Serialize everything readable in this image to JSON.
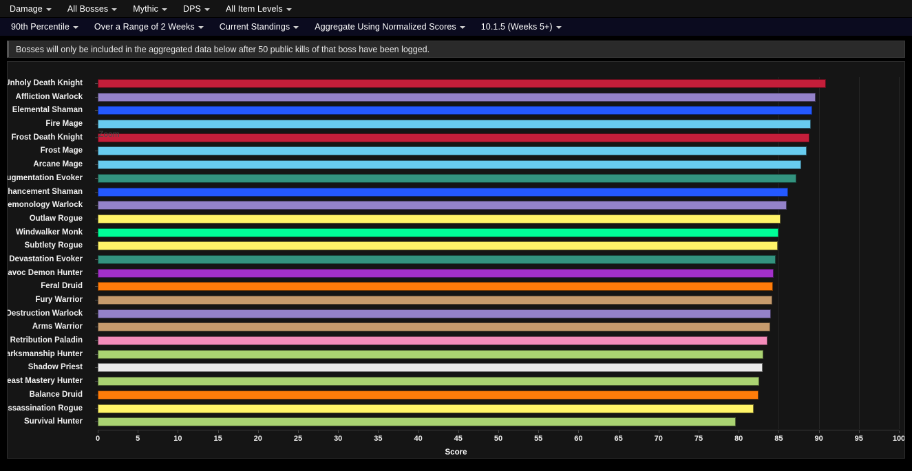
{
  "menubar_primary": [
    {
      "label": "Damage",
      "caret": true
    },
    {
      "label": "All Bosses",
      "caret": true
    },
    {
      "label": "Mythic",
      "caret": true
    },
    {
      "label": "DPS",
      "caret": true
    },
    {
      "label": "All Item Levels",
      "caret": true
    }
  ],
  "menubar_secondary": [
    {
      "label": "90th Percentile",
      "caret": true
    },
    {
      "label": "Over a Range of 2 Weeks",
      "caret": true
    },
    {
      "label": "Current Standings",
      "caret": true
    },
    {
      "label": "Aggregate Using Normalized Scores",
      "caret": true
    },
    {
      "label": "10.1.5 (Weeks 5+)",
      "caret": true
    }
  ],
  "notice": {
    "text": "Bosses will only be included in the aggregated data below after 50 public kills of that boss have been logged."
  },
  "chart_panel": {
    "zoom_label": "Zoom"
  },
  "chart_data": {
    "type": "bar",
    "orientation": "horizontal",
    "title": "",
    "xlabel": "Score",
    "ylabel": "",
    "xlim": [
      0,
      100
    ],
    "xticks": [
      0,
      5,
      10,
      15,
      20,
      25,
      30,
      35,
      40,
      45,
      50,
      55,
      60,
      65,
      70,
      75,
      80,
      85,
      90,
      95,
      100
    ],
    "gridlines": [
      85,
      90,
      95,
      100
    ],
    "grid": true,
    "legend": "none",
    "categories": [
      "Unholy Death Knight",
      "Affliction Warlock",
      "Elemental Shaman",
      "Fire Mage",
      "Frost Death Knight",
      "Frost Mage",
      "Arcane Mage",
      "Augmentation Evoker",
      "Enhancement Shaman",
      "Demonology Warlock",
      "Outlaw Rogue",
      "Windwalker Monk",
      "Subtlety Rogue",
      "Devastation Evoker",
      "Havoc Demon Hunter",
      "Feral Druid",
      "Fury Warrior",
      "Destruction Warlock",
      "Arms Warrior",
      "Retribution Paladin",
      "Marksmanship Hunter",
      "Shadow Priest",
      "Beast Mastery Hunter",
      "Balance Druid",
      "Assassination Rogue",
      "Survival Hunter"
    ],
    "values": [
      90.9,
      89.6,
      89.2,
      89.0,
      88.8,
      88.5,
      87.8,
      87.2,
      86.2,
      86.0,
      85.2,
      85.0,
      84.9,
      84.6,
      84.4,
      84.3,
      84.2,
      84.0,
      83.9,
      83.6,
      83.1,
      83.0,
      82.6,
      82.5,
      81.9,
      79.6
    ],
    "colors": [
      "#c41e3a",
      "#9482c9",
      "#2459ff",
      "#68ccef",
      "#c41e3a",
      "#68ccef",
      "#68ccef",
      "#33937f",
      "#2459ff",
      "#9482c9",
      "#fff468",
      "#00ff98",
      "#fff468",
      "#33937f",
      "#a330c9",
      "#ff7c0a",
      "#c69b6d",
      "#9482c9",
      "#c69b6d",
      "#f48cba",
      "#aad372",
      "#ececec",
      "#aad372",
      "#ff7c0a",
      "#fff468",
      "#aad372"
    ]
  }
}
